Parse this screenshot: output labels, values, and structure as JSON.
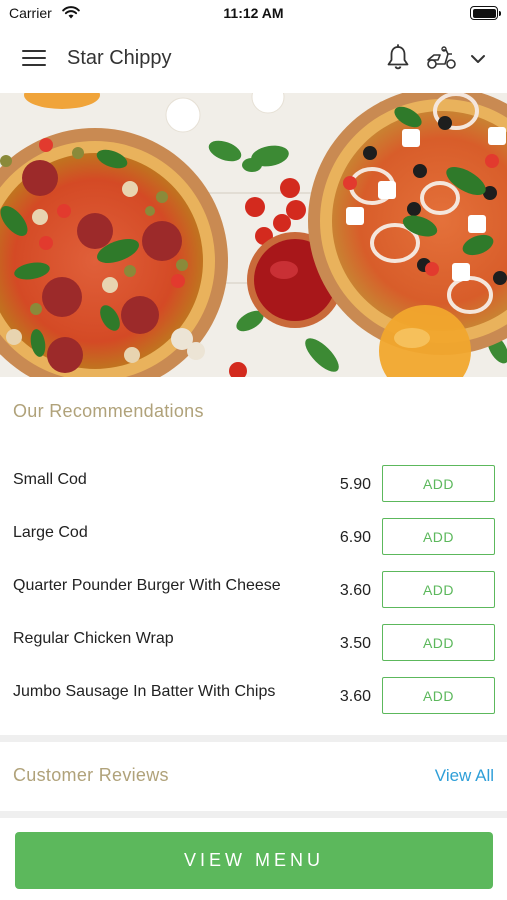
{
  "status_bar": {
    "carrier": "Carrier",
    "time": "11:12 AM"
  },
  "header": {
    "title": "Star Chippy"
  },
  "hero": {
    "image": "pizza-banner"
  },
  "recommendations": {
    "title": "Our Recommendations",
    "items": [
      {
        "name": "Small Cod",
        "price": "5.90",
        "button": "ADD"
      },
      {
        "name": "Large Cod",
        "price": "6.90",
        "button": "ADD"
      },
      {
        "name": "Quarter Pounder Burger With Cheese",
        "price": "3.60",
        "button": "ADD"
      },
      {
        "name": "Regular Chicken Wrap",
        "price": "3.50",
        "button": "ADD"
      },
      {
        "name": "Jumbo Sausage In Batter With Chips",
        "price": "3.60",
        "button": "ADD"
      }
    ]
  },
  "reviews": {
    "title": "Customer Reviews",
    "view_all": "View All"
  },
  "bottom": {
    "view_menu": "VIEW MENU"
  },
  "colors": {
    "accent_green": "#5cb85c",
    "section_title": "#b0a27a",
    "link_blue": "#2f9fd8"
  },
  "icons": [
    "wifi-icon",
    "battery-icon",
    "menu-icon",
    "bell-icon",
    "scooter-icon",
    "chevron-down-icon"
  ]
}
